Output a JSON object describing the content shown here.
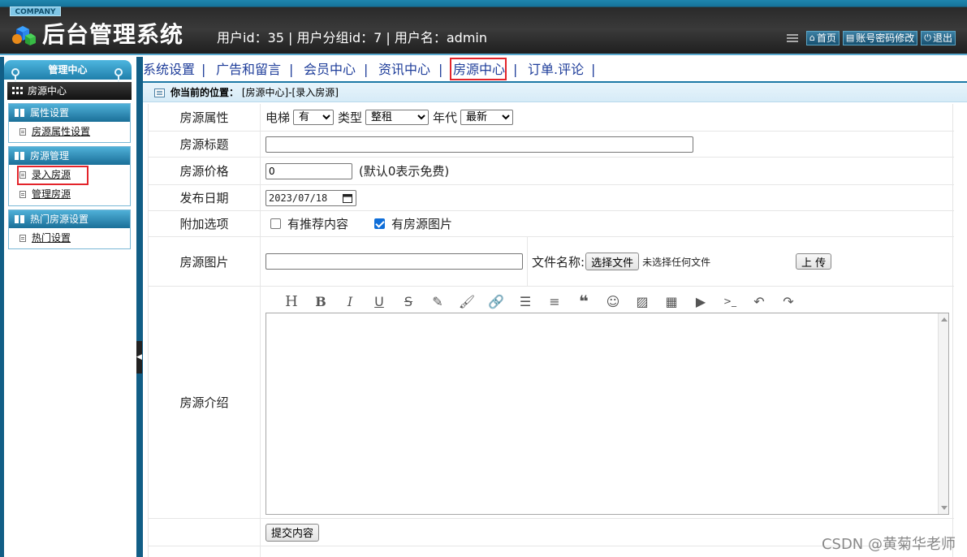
{
  "header": {
    "company_badge": "COMPANY",
    "system_title": "后台管理系统",
    "user_info": "用户id：35 | 用户分组id：7 | 用户名：admin",
    "buttons": [
      {
        "icon": "home-icon",
        "label": "首页"
      },
      {
        "icon": "document-icon",
        "label": "账号密码修改"
      },
      {
        "icon": "power-icon",
        "label": "退出"
      }
    ]
  },
  "sidebar": {
    "title": "管理中心",
    "section": "房源中心",
    "groups": [
      {
        "title": "属性设置",
        "items": [
          "房源属性设置"
        ]
      },
      {
        "title": "房源管理",
        "items": [
          "录入房源",
          "管理房源"
        ]
      },
      {
        "title": "热门房源设置",
        "items": [
          "热门设置"
        ]
      }
    ]
  },
  "nav": {
    "items": [
      "系统设置",
      "广告和留言",
      "会员中心",
      "资讯中心",
      "房源中心",
      "订单.评论"
    ],
    "separator": "|",
    "active": "房源中心"
  },
  "breadcrumb": {
    "label": "你当前的位置：",
    "path": "[房源中心]-[录入房源]"
  },
  "form": {
    "attr_label": "房源属性",
    "elevator_label": "电梯",
    "elevator_value": "有",
    "type_label": "类型",
    "type_value": "整租",
    "era_label": "年代",
    "era_value": "最新",
    "title_label": "房源标题",
    "title_value": "",
    "price_label": "房源价格",
    "price_value": "0",
    "price_hint": "(默认0表示免费)",
    "date_label": "发布日期",
    "date_value": "2023/07/18",
    "options_label": "附加选项",
    "option_recommend": "有推荐内容",
    "option_recommend_checked": false,
    "option_images": "有房源图片",
    "option_images_checked": true,
    "image_label": "房源图片",
    "image_path": "",
    "file_name_label": "文件名称:",
    "choose_file": "选择文件",
    "no_file": "未选择任何文件",
    "upload": "上 传",
    "intro_label": "房源介绍",
    "toolbar_icons": [
      "heading-icon",
      "bold-icon",
      "italic-icon",
      "underline-icon",
      "strikethrough-icon",
      "highlight-icon",
      "brush-icon",
      "link-icon",
      "list-icon",
      "align-icon",
      "quote-icon",
      "emoji-icon",
      "image-icon",
      "table-icon",
      "video-icon",
      "code-icon",
      "undo-icon",
      "redo-icon"
    ],
    "submit": "提交内容"
  },
  "watermark": "CSDN @黄菊华老师",
  "colors": {
    "nav_text": "#1e3d9a",
    "highlight_box": "#e3242b",
    "sidebar": "#125e86"
  }
}
